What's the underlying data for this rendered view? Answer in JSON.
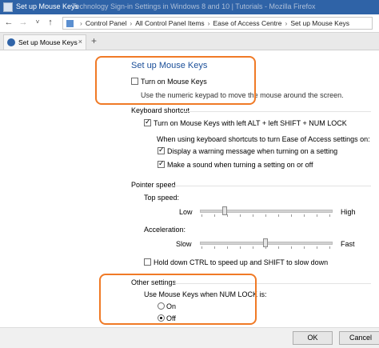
{
  "window": {
    "title": "Set up Mouse Keys",
    "background_title": "Technology Sign-in Settings in Windows 8 and 10 | Tutorials - Mozilla Firefox"
  },
  "addressbar": {
    "back_icon": "back-arrow-icon",
    "forward_icon": "forward-arrow-icon",
    "history_icon": "chevron-down-icon",
    "up_icon": "up-arrow-icon",
    "breadcrumbs": [
      "Control Panel",
      "All Control Panel Items",
      "Ease of Access Centre",
      "Set up Mouse Keys"
    ]
  },
  "tabs": {
    "active_label": "Set up Mouse Keys",
    "new_tab": "+"
  },
  "main": {
    "title": "Set up Mouse Keys",
    "turn_on_label": "Turn on Mouse Keys",
    "turn_on_checked": false,
    "description": "Use the numeric keypad to move the mouse around the screen.",
    "keyboard_shortcut": {
      "heading": "Keyboard shortcut",
      "shortcut_label": "Turn on Mouse Keys with left ALT + left SHIFT + NUM LOCK",
      "shortcut_checked": true,
      "note": "When using keyboard shortcuts to turn Ease of Access settings on:",
      "warning_label": "Display a warning message when turning on a setting",
      "warning_checked": true,
      "sound_label": "Make a sound when turning a setting on or off",
      "sound_checked": true
    },
    "pointer_speed": {
      "heading": "Pointer speed",
      "top_speed_label": "Top speed:",
      "top_low": "Low",
      "top_high": "High",
      "top_speed_level": 0.18,
      "acceleration_label": "Acceleration:",
      "acc_slow": "Slow",
      "acc_fast": "Fast",
      "acceleration_level": 0.5,
      "hold_label": "Hold down CTRL to speed up and SHIFT to slow down",
      "hold_checked": false
    },
    "other_settings": {
      "heading": "Other settings",
      "num_lock_question": "Use Mouse Keys when NUM LOCK is:",
      "option_on": "On",
      "option_off": "Off",
      "selected": "Off"
    }
  },
  "footer": {
    "ok_label": "OK",
    "cancel_label": "Cancel"
  },
  "colors": {
    "highlight_ring": "#f07a26",
    "heading_blue": "#1b4f99",
    "titlebar": "#2f63a7"
  }
}
